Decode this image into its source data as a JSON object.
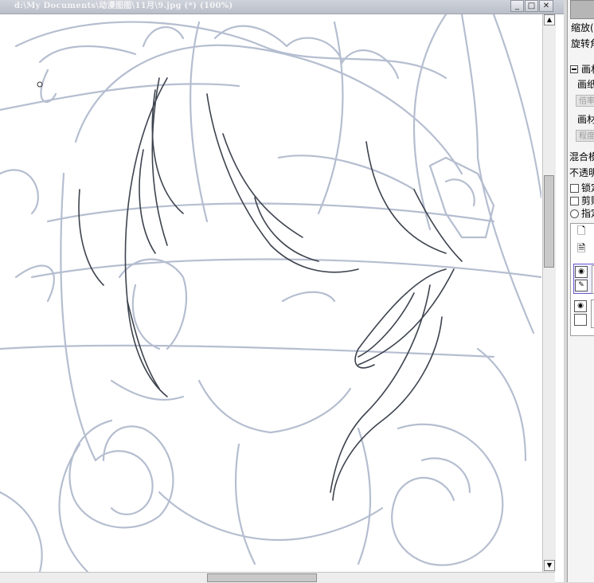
{
  "window": {
    "title": "d:\\My Documents\\动漫图图\\11月\\9.jpg (*) (100%)",
    "buttons": [
      "_",
      "□",
      "✕"
    ]
  },
  "canvas": {
    "sketch_stroke": "#a9b3c8",
    "lineart_stroke": "#3d434e"
  },
  "scrollbar": {
    "up": "▲",
    "down": "▼",
    "left": "◀",
    "right": "▶"
  },
  "panel": {
    "zoom_label": "缩放(",
    "rotate_label": "旋转角",
    "canvas_section": "画材",
    "paper_label": "画纸",
    "paper_value": "倍率",
    "material_label": "画材",
    "material_value": "程度",
    "blend_label": "混合模",
    "opacity_label": "不透明",
    "lock_label": "锁定",
    "clip_label": "剪贴",
    "select_label": "指定"
  },
  "colors": {
    "accent": "#6a5acd"
  }
}
